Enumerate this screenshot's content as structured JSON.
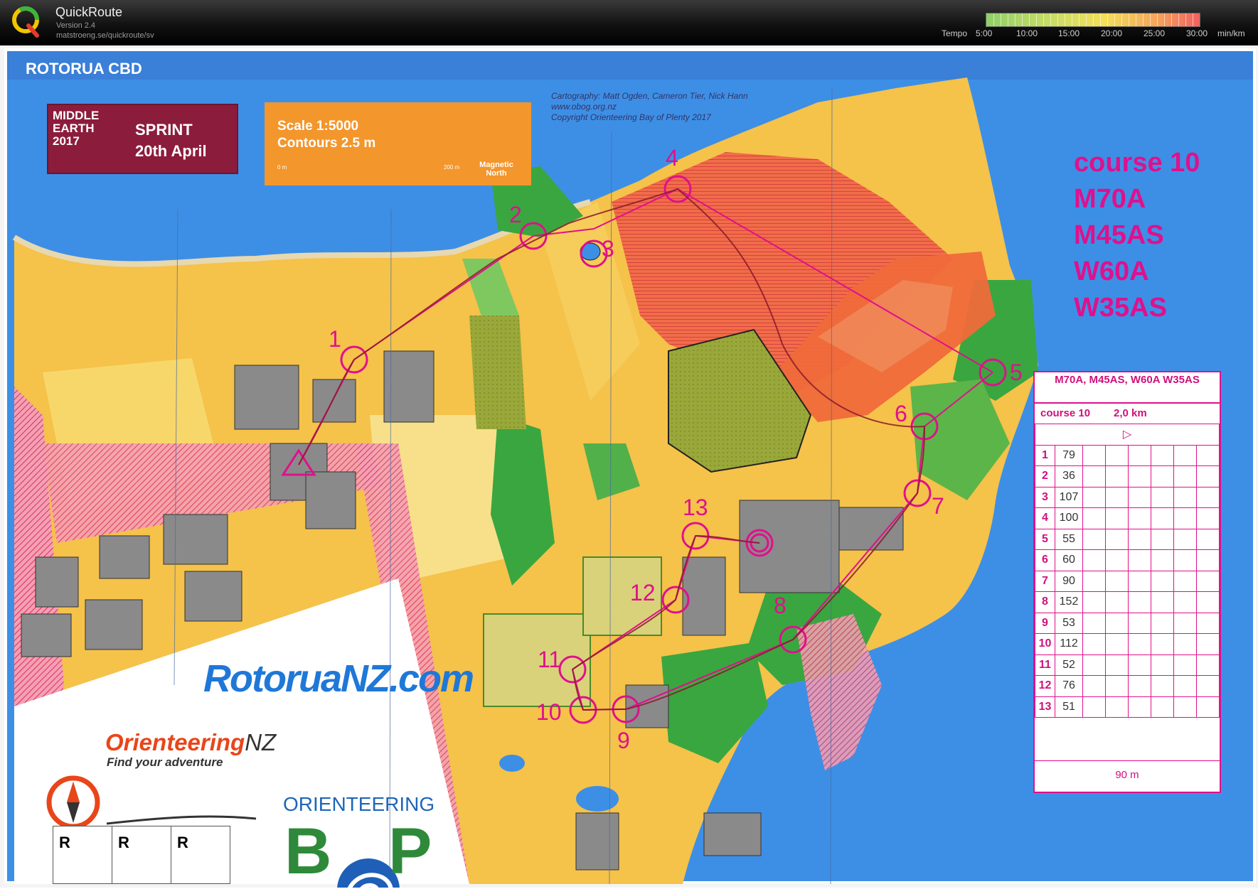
{
  "app": {
    "name": "QuickRoute",
    "version": "Version 2.4",
    "url": "matstroeng.se/quickroute/sv"
  },
  "tempo": {
    "label": "Tempo",
    "ticks": [
      "5:00",
      "10:00",
      "15:00",
      "20:00",
      "25:00",
      "30:00"
    ],
    "unit": "min/km"
  },
  "map": {
    "area_name": "ROTORUA CBD",
    "event": {
      "vertical_lines": [
        "MIDDLE",
        "EARTH",
        "2017"
      ],
      "race": "SPRINT",
      "date": "20th April"
    },
    "scale": {
      "scale_text": "Scale 1:5000",
      "contours_text": "Contours 2.5 m",
      "bar_start": "0 m",
      "bar_end": "200 m",
      "north_label": "Magnetic North"
    },
    "credits": [
      "Cartography: Matt Ogden, Cameron Tier, Nick Hann",
      "www.obog.org.nz",
      "Copyright Orienteering Bay of Plenty 2017"
    ],
    "course_labels": [
      "course 10",
      "M70A",
      "M45AS",
      "W60A",
      "W35AS"
    ],
    "control_numbers": [
      "1",
      "2",
      "3",
      "4",
      "5",
      "6",
      "7",
      "8",
      "9",
      "10",
      "11",
      "12",
      "13"
    ],
    "description": {
      "header": "M70A, M45AS, W60A W35AS",
      "course": "course 10",
      "length": "2,0 km",
      "controls": [
        {
          "n": "1",
          "code": "79"
        },
        {
          "n": "2",
          "code": "36"
        },
        {
          "n": "3",
          "code": "107"
        },
        {
          "n": "4",
          "code": "100"
        },
        {
          "n": "5",
          "code": "55"
        },
        {
          "n": "6",
          "code": "60"
        },
        {
          "n": "7",
          "code": "90"
        },
        {
          "n": "8",
          "code": "152"
        },
        {
          "n": "9",
          "code": "53"
        },
        {
          "n": "10",
          "code": "112"
        },
        {
          "n": "11",
          "code": "52"
        },
        {
          "n": "12",
          "code": "76"
        },
        {
          "n": "13",
          "code": "51"
        }
      ],
      "finish": "90 m"
    },
    "sponsors": {
      "rotorua": "RotoruaNZ.com",
      "onz_main": "Orienteering",
      "onz_nz": "NZ",
      "onz_tagline": "Find your adventure",
      "bop_top": "ORIENTEERING",
      "bop_b": "B",
      "bop_p": "P"
    },
    "r_boxes": [
      "R",
      "R",
      "R"
    ]
  },
  "colors": {
    "course": "#e0108c",
    "water": "#3d8fe6",
    "open_land": "#f5c24a",
    "forest": "#3aa640",
    "buildings": "#8a8a8a",
    "out_of_bounds": "#e8463c"
  }
}
